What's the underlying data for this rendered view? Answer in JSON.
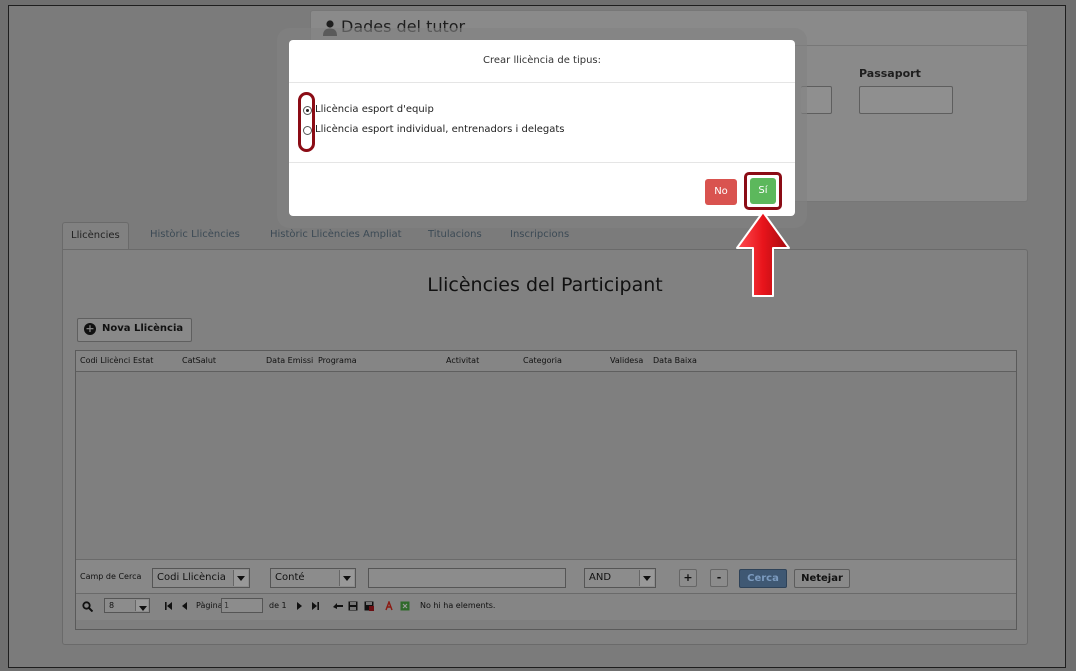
{
  "tutor": {
    "title": "Dades del tutor",
    "passaport_label": "Passaport",
    "passaport_value": ""
  },
  "tabs": [
    {
      "label": "Llicències",
      "active": true
    },
    {
      "label": "Històric Llicències",
      "active": false
    },
    {
      "label": "Històric Llicències Ampliat",
      "active": false
    },
    {
      "label": "Titulacions",
      "active": false
    },
    {
      "label": "Inscripcions",
      "active": false
    }
  ],
  "main": {
    "title": "Llicències del Participant",
    "nova_button": "Nova Llicència",
    "columns": [
      "Codi Llicènci",
      "Estat",
      "CatSalut",
      "Data Emissi",
      "Programa",
      "Activitat",
      "Categoria",
      "Validesa",
      "Data Baixa"
    ]
  },
  "search": {
    "label": "Camp de Cerca",
    "field": "Codi Llicència",
    "operator": "Conté",
    "value": "",
    "logic": "AND",
    "add": "+",
    "remove": "-",
    "cerca": "Cerca",
    "netejar": "Netejar"
  },
  "pager": {
    "page_size": "8",
    "page_label": "Pàgina",
    "page_value": "1",
    "of_label": "de 1",
    "status": "No hi ha elements."
  },
  "modal": {
    "title": "Crear llicència de tipus:",
    "options": [
      {
        "label": "Llicència esport d'equip",
        "checked": true
      },
      {
        "label": "Llicència esport individual, entrenadors i delegats",
        "checked": false
      }
    ],
    "no": "No",
    "si": "Sí"
  },
  "colors": {
    "highlight": "#8b0c15",
    "arrow": "#e8141b",
    "btn_no": "#d9534f",
    "btn_si": "#5cb85c"
  }
}
